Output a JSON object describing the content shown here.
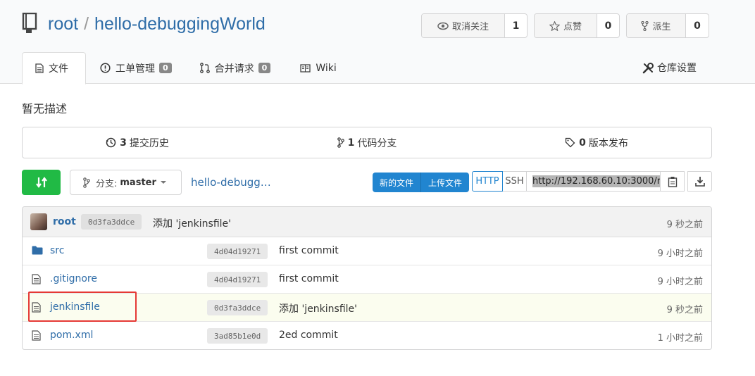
{
  "repo": {
    "owner": "root",
    "separator": "/",
    "name": "hello-debuggingWorld"
  },
  "actions": {
    "watch": {
      "label": "取消关注",
      "count": "1"
    },
    "star": {
      "label": "点赞",
      "count": "0"
    },
    "fork": {
      "label": "派生",
      "count": "0"
    }
  },
  "tabs": [
    {
      "label": "文件"
    },
    {
      "label": "工单管理",
      "badge": "0"
    },
    {
      "label": "合并请求",
      "badge": "0"
    },
    {
      "label": "Wiki"
    }
  ],
  "settings_label": "仓库设置",
  "description": "暂无描述",
  "stats": {
    "commits": {
      "count": "3",
      "label": "提交历史"
    },
    "branches": {
      "count": "1",
      "label": "代码分支"
    },
    "releases": {
      "count": "0",
      "label": "版本发布"
    }
  },
  "toolbar": {
    "branch_prefix": "分支:",
    "branch": "master",
    "breadcrumb": "hello-debugg…",
    "new_file": "新的文件",
    "upload_file": "上传文件",
    "http": "HTTP",
    "ssh": "SSH",
    "clone_url": "http://192.168.60.10:3000/r"
  },
  "latest_commit": {
    "user": "root",
    "sha": "0d3fa3ddce",
    "message": "添加 'jenkinsfile'",
    "time": "9 秒之前"
  },
  "files": [
    {
      "type": "folder",
      "name": "src",
      "sha": "4d04d19271",
      "message": "first commit",
      "time": "9 小时之前"
    },
    {
      "type": "file",
      "name": ".gitignore",
      "sha": "4d04d19271",
      "message": "first commit",
      "time": "9 小时之前"
    },
    {
      "type": "file",
      "name": "jenkinsfile",
      "sha": "0d3fa3ddce",
      "message": "添加 'jenkinsfile'",
      "time": "9 秒之前"
    },
    {
      "type": "file",
      "name": "pom.xml",
      "sha": "3ad85b1e0d",
      "message": "2ed commit",
      "time": "1 小时之前"
    }
  ],
  "colors": {
    "link": "#2f6da8",
    "green": "#21ba45",
    "blue": "#2185d0",
    "highlight_box": "#e53935"
  }
}
